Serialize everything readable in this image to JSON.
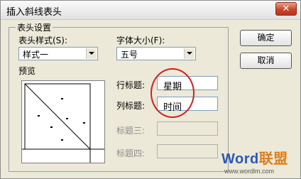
{
  "window": {
    "title": "插入斜线表头",
    "close_glyph": "✕"
  },
  "group": {
    "title": "表头设置"
  },
  "fields": {
    "style_label": "表头样式(S):",
    "style_value": "样式一",
    "fontsize_label": "字体大小(F):",
    "fontsize_value": "五号",
    "preview_label": "预览",
    "row_title_label": "行标题:",
    "row_title_value": "星期",
    "col_title_label": "列标题:",
    "col_title_value": "时间",
    "title3_label": "标题三:",
    "title3_value": "",
    "title4_label": "标题四:",
    "title4_value": ""
  },
  "buttons": {
    "ok": "确定",
    "cancel": "取消"
  },
  "watermark": {
    "brand_a": "Word",
    "brand_b": "联盟",
    "url": "www.wordlm.com"
  },
  "colors": {
    "highlight_circle": "#d02020"
  }
}
